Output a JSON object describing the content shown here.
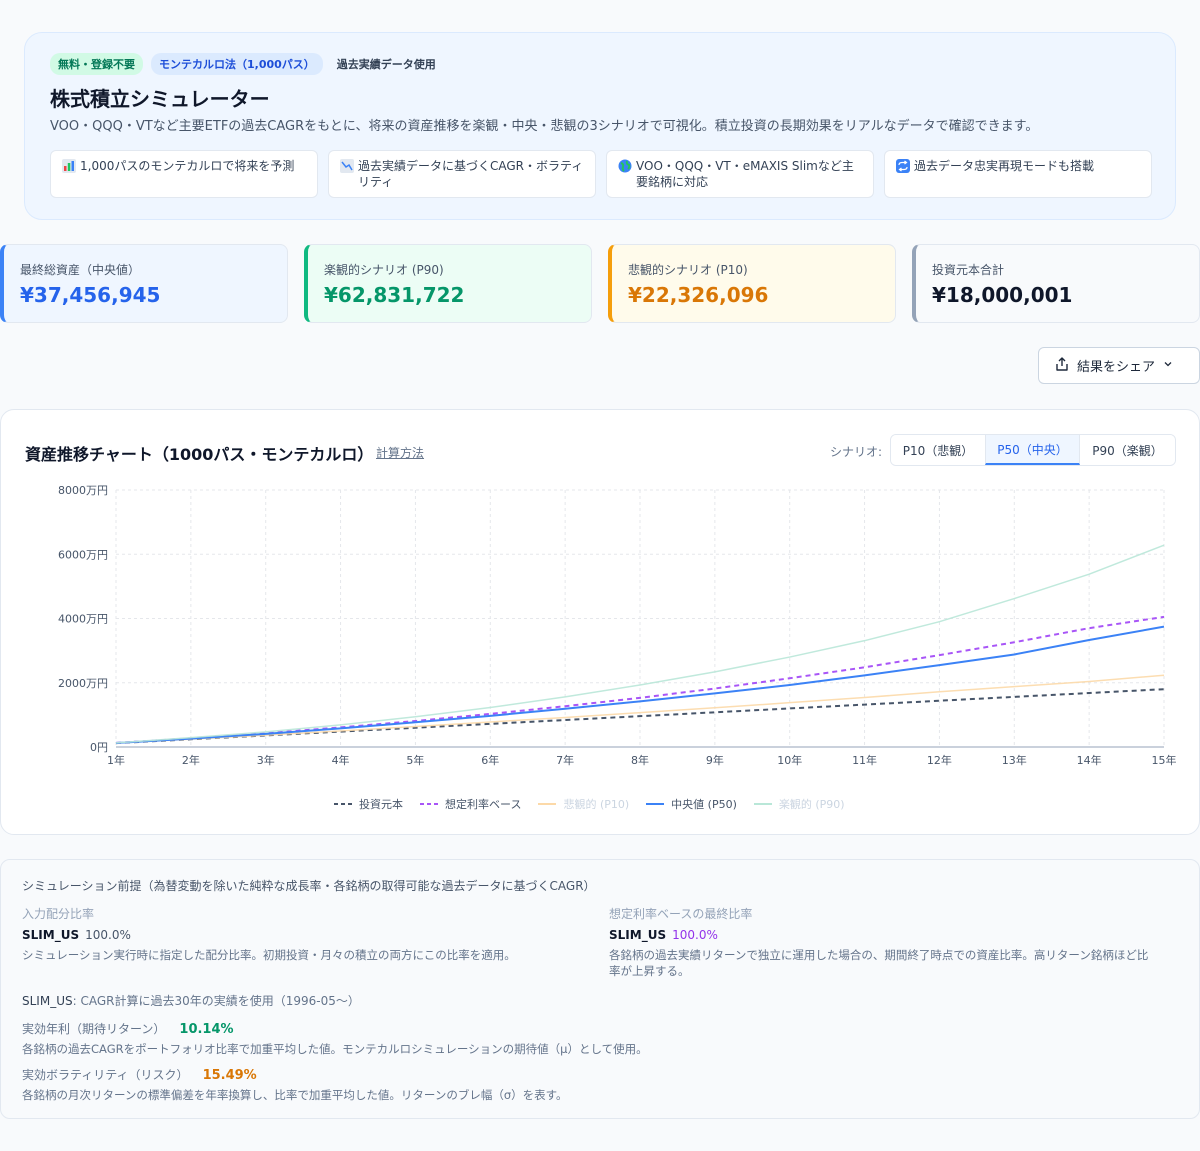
{
  "hero": {
    "badges": [
      "無料・登録不要",
      "モンテカルロ法（1,000パス）",
      "過去実績データ使用"
    ],
    "title": "株式積立シミュレーター",
    "description": "VOO・QQQ・VTなど主要ETFの過去CAGRをもとに、将来の資産推移を楽観・中央・悲観の3シナリオで可視化。積立投資の長期効果をリアルなデータで確認できます。",
    "features": [
      {
        "icon": "bar-chart-icon",
        "text": "1,000パスのモンテカルロで将来を予測"
      },
      {
        "icon": "trend-chart-icon",
        "text": "過去実績データに基づくCAGR・ボラティリティ"
      },
      {
        "icon": "globe-icon",
        "text": "VOO・QQQ・VT・eMAXIS Slimなど主要銘柄に対応"
      },
      {
        "icon": "repeat-icon",
        "text": "過去データ忠実再現モードも搭載"
      }
    ]
  },
  "stats": [
    {
      "label": "最終総資産（中央値）",
      "value": "¥37,456,945",
      "color": "#2563eb",
      "bg": "#eff6ff",
      "border": "#3b82f6"
    },
    {
      "label": "楽観的シナリオ (P90)",
      "value": "¥62,831,722",
      "color": "#059669",
      "bg": "#ecfdf5",
      "border": "#10b981"
    },
    {
      "label": "悲観的シナリオ (P10)",
      "value": "¥22,326,096",
      "color": "#d97706",
      "bg": "#fffbeb",
      "border": "#f59e0b"
    },
    {
      "label": "投資元本合計",
      "value": "¥18,000,001",
      "color": "#0f172a",
      "bg": "#f8fafc",
      "border": "#94a3b8"
    }
  ],
  "share": {
    "label": "結果をシェア"
  },
  "chart": {
    "title": "資産推移チャート（1000パス・モンテカルロ）",
    "calc_link": "計算方法",
    "scenario_label": "シナリオ:",
    "scenarios": [
      "P10（悲観）",
      "P50（中央）",
      "P90（楽観）"
    ],
    "active_scenario": 1
  },
  "chart_data": {
    "type": "line",
    "x": [
      "1年",
      "2年",
      "3年",
      "4年",
      "5年",
      "6年",
      "7年",
      "8年",
      "9年",
      "10年",
      "11年",
      "12年",
      "13年",
      "14年",
      "15年"
    ],
    "yticks": [
      "0円",
      "2000万円",
      "4000万円",
      "6000万円",
      "8000万円"
    ],
    "ylim": [
      0,
      8000
    ],
    "yunit": "万円",
    "grid": true,
    "legend_position": "bottom",
    "series": [
      {
        "name": "投資元本",
        "color": "#475569",
        "dash": true,
        "dim": false,
        "values": [
          120,
          240,
          360,
          480,
          600,
          720,
          840,
          960,
          1080,
          1200,
          1320,
          1440,
          1560,
          1680,
          1800
        ]
      },
      {
        "name": "想定利率ベース",
        "color": "#a855f7",
        "dash": true,
        "dim": false,
        "values": [
          128,
          270,
          430,
          610,
          810,
          1030,
          1270,
          1530,
          1820,
          2140,
          2480,
          2860,
          3260,
          3700,
          4050
        ]
      },
      {
        "name": "悲観的 (P10)",
        "color": "#fcd9a8",
        "dash": false,
        "dim": true,
        "values": [
          120,
          245,
          370,
          500,
          640,
          780,
          920,
          1070,
          1220,
          1380,
          1540,
          1720,
          1880,
          2040,
          2233
        ]
      },
      {
        "name": "中央値 (P50)",
        "color": "#3b82f6",
        "dash": false,
        "dim": false,
        "values": [
          125,
          262,
          410,
          580,
          770,
          970,
          1190,
          1420,
          1670,
          1930,
          2230,
          2550,
          2880,
          3330,
          3746
        ]
      },
      {
        "name": "楽観的 (P90)",
        "color": "#b9e7d8",
        "dash": false,
        "dim": true,
        "values": [
          130,
          290,
          470,
          690,
          940,
          1230,
          1560,
          1930,
          2340,
          2800,
          3310,
          3900,
          4620,
          5380,
          6283
        ]
      }
    ]
  },
  "assumptions": {
    "title": "シミュレーション前提（為替変動を除いた純粋な成長率・各銘柄の取得可能な過去データに基づくCAGR）",
    "left_heading": "入力配分比率",
    "left_asset": "SLIM_US",
    "left_pct": "100.0%",
    "left_note": "シミュレーション実行時に指定した配分比率。初期投資・月々の積立の両方にこの比率を適用。",
    "right_heading": "想定利率ベースの最終比率",
    "right_asset": "SLIM_US",
    "right_pct": "100.0%",
    "right_note_1": "各銘柄の過去実績リターンで独立に運用した場合の、期間終了時点での資産比率。高リターン銘柄ほど比",
    "right_note_2": "率が上昇する。",
    "cagr_asset": "SLIM_US",
    "cagr_note": ": CAGR計算に過去30年の実績を使用（1996-05〜）",
    "return_label": "実効年利（期待リターン）",
    "return_value": "10.14%",
    "return_note": "各銘柄の過去CAGRをポートフォリオ比率で加重平均した値。モンテカルロシミュレーションの期待値（μ）として使用。",
    "vol_label": "実効ボラティリティ（リスク）",
    "vol_value": "15.49%",
    "vol_note": "各銘柄の月次リターンの標準偏差を年率換算し、比率で加重平均した値。リターンのブレ幅（σ）を表す。"
  }
}
